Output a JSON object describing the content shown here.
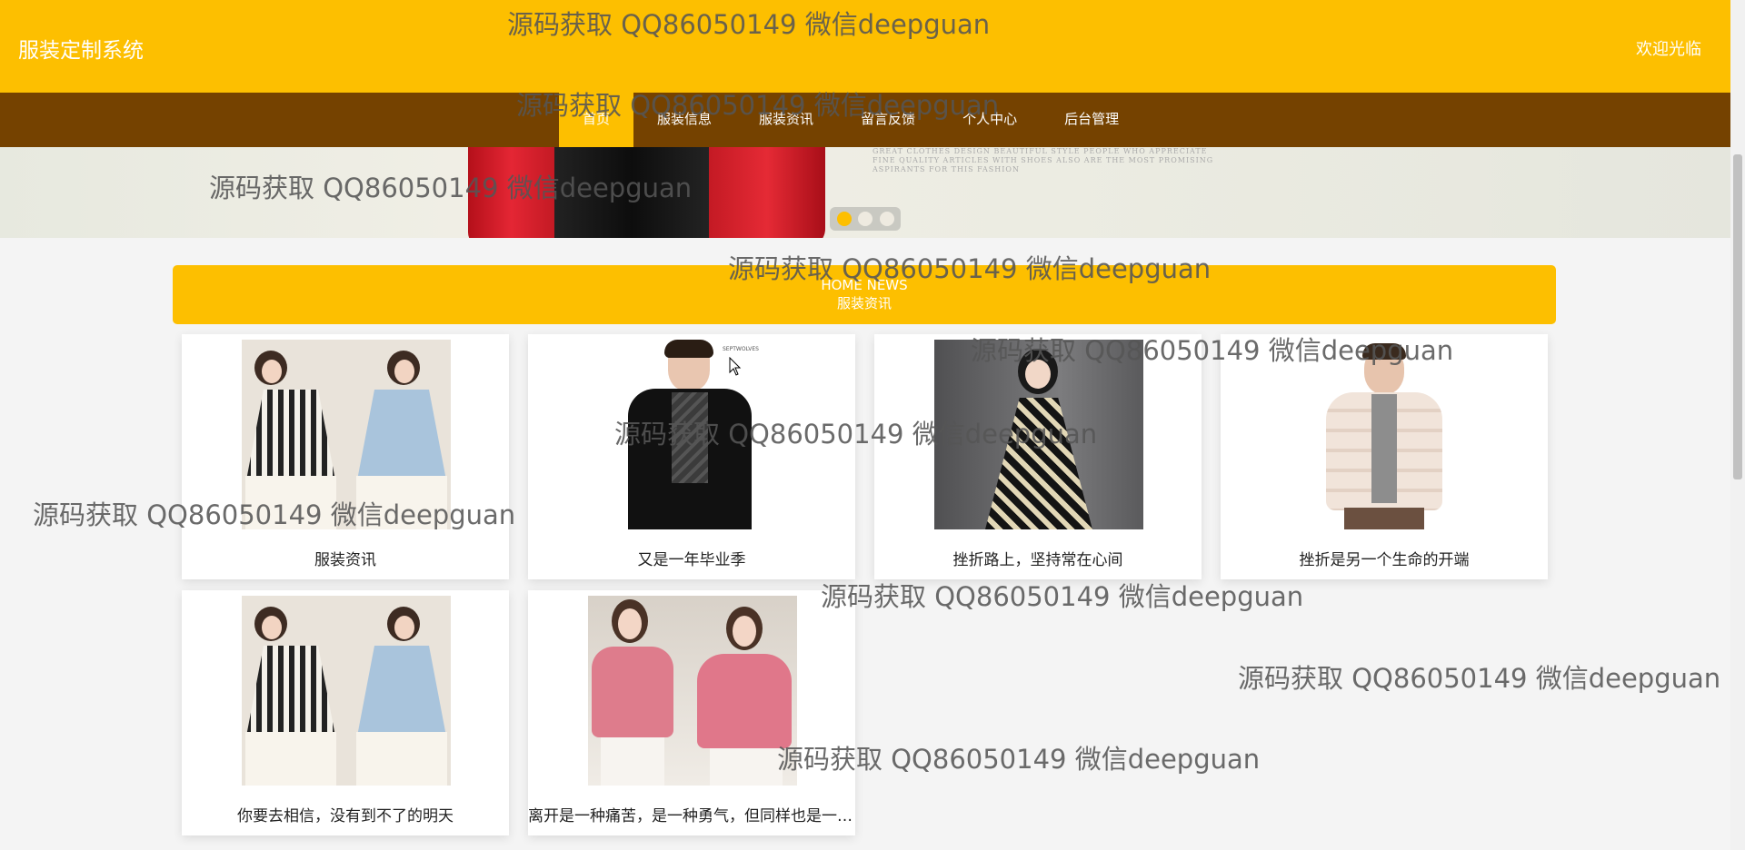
{
  "header": {
    "site_title": "服装定制系统",
    "welcome": "欢迎光临"
  },
  "nav": {
    "items": [
      {
        "label": "首页",
        "active": true
      },
      {
        "label": "服装信息",
        "active": false
      },
      {
        "label": "服装资讯",
        "active": false
      },
      {
        "label": "留言反馈",
        "active": false
      },
      {
        "label": "个人中心",
        "active": false
      },
      {
        "label": "后台管理",
        "active": false
      }
    ]
  },
  "banner": {
    "tagline": "GREAT CLOTHES DESIGN BEAUTIFUL STYLE PEOPLE WHO APPRECIATE FINE QUALITY ARTICLES WITH SHOES ALSO ARE THE MOST PROMISING ASPIRANTS FOR THIS FASHION",
    "slides": 3,
    "active_slide": 1
  },
  "news_section": {
    "title_en": "HOME NEWS",
    "title_cn": "服装资讯",
    "cards": [
      {
        "caption": "服装资讯",
        "image": "two-women-striped-blue-dresses"
      },
      {
        "caption": "又是一年毕业季",
        "image": "man-black-coat-scarf",
        "brand_label": "SEPTWOLVES"
      },
      {
        "caption": "挫折路上，坚持常在心间",
        "image": "girl-patterned-dress"
      },
      {
        "caption": "挫折是另一个生命的开端",
        "image": "man-white-puffer-jacket"
      },
      {
        "caption": "你要去相信，没有到不了的明天",
        "image": "two-women-striped-blue-dresses"
      },
      {
        "caption": "离开是一种痛苦，是一种勇气，但同样也是一种希望",
        "image": "two-women-pink-tops"
      }
    ]
  },
  "watermark_text": "源码获取 QQ86050149 微信deepguan",
  "colors": {
    "primary": "#fdbf00",
    "nav_bg": "#754200",
    "page_bg": "#f4f4f4"
  }
}
